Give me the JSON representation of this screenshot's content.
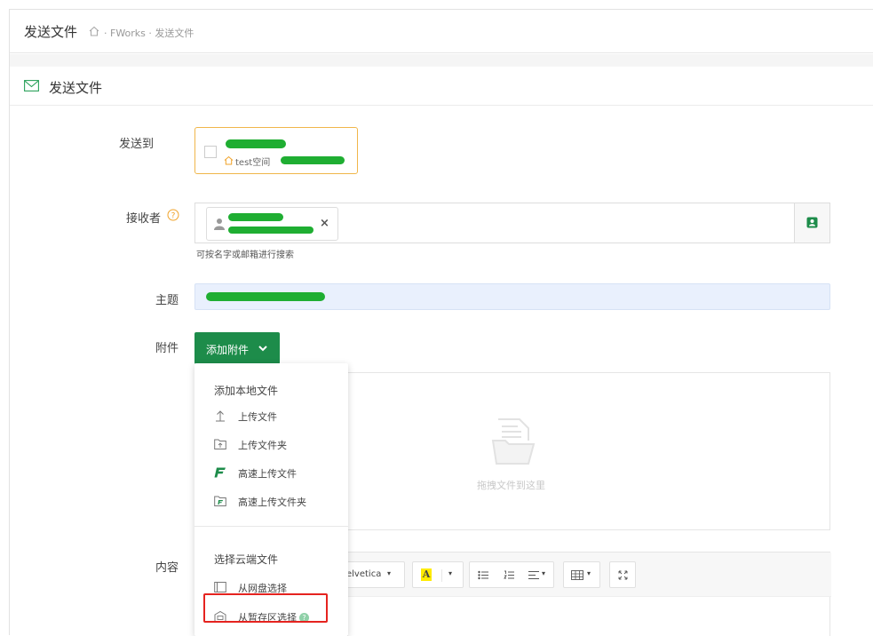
{
  "breadcrumb": {
    "title": "发送文件",
    "path": [
      "FWorks",
      "发送文件"
    ],
    "separator": "·"
  },
  "panel": {
    "title": "发送文件",
    "icon": "mail-icon"
  },
  "form": {
    "send_to": {
      "label": "发送到",
      "space_name": "test空间"
    },
    "receiver": {
      "label": "接收者",
      "help_icon": "question-circle-icon",
      "remove_symbol": "×",
      "hint": "可按名字或邮箱进行搜索",
      "contact_icon": "contact-book-icon"
    },
    "subject": {
      "label": "主题"
    },
    "attachment": {
      "label": "附件",
      "button_label": "添加附件"
    },
    "content": {
      "label": "内容"
    }
  },
  "dropdown": {
    "local_section": "添加本地文件",
    "local_items": [
      {
        "label": "上传文件",
        "icon": "upload-icon"
      },
      {
        "label": "上传文件夹",
        "icon": "upload-folder-icon"
      },
      {
        "label": "高速上传文件",
        "icon": "fast-upload-icon"
      },
      {
        "label": "高速上传文件夹",
        "icon": "fast-upload-folder-icon"
      }
    ],
    "cloud_section": "选择云端文件",
    "cloud_items": [
      {
        "label": "从网盘选择",
        "icon": "netdisk-icon"
      },
      {
        "label": "从暂存区选择",
        "icon": "staging-icon",
        "highlighted": true
      }
    ]
  },
  "dropzone": {
    "text": "拖拽文件到这里"
  },
  "editor": {
    "font_name": "elvetica",
    "font_color_glyph": "A",
    "toolbar_icons": [
      "font-color-icon",
      "bullet-list-icon",
      "numbered-list-icon",
      "align-icon",
      "table-icon",
      "fullscreen-icon"
    ]
  },
  "colors": {
    "primary_green": "#1d8c4a",
    "highlight_red": "#e5231f",
    "send_border": "#f0b64a",
    "subject_bg": "#e9f0fd"
  }
}
